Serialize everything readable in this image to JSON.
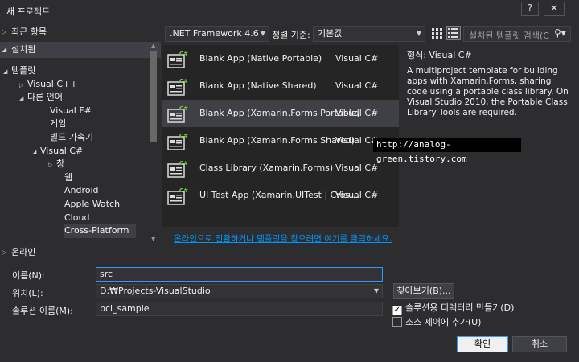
{
  "window": {
    "title": "새 프로젝트",
    "help": "?",
    "close": "✕"
  },
  "left": {
    "recent": "최근 항목",
    "installed": "설치됨",
    "online": "온라인",
    "tree": [
      {
        "label": "템플릿",
        "arrow": "◢",
        "indent": 0
      },
      {
        "label": "Visual C++",
        "arrow": "▷",
        "indent": 1
      },
      {
        "label": "다른 언어",
        "arrow": "◢",
        "indent": 1
      },
      {
        "label": "Visual F#",
        "arrow": "",
        "indent": 2
      },
      {
        "label": "게임",
        "arrow": "",
        "indent": 2
      },
      {
        "label": "빌드 가속기",
        "arrow": "",
        "indent": 2
      },
      {
        "label": "Visual C#",
        "arrow": "◢",
        "indent": 2
      },
      {
        "label": "창",
        "arrow": "▷",
        "indent": 3
      },
      {
        "label": "웹",
        "arrow": "",
        "indent": 3
      },
      {
        "label": "Android",
        "arrow": "",
        "indent": 3
      },
      {
        "label": "Apple Watch",
        "arrow": "",
        "indent": 3
      },
      {
        "label": "Cloud",
        "arrow": "",
        "indent": 3
      },
      {
        "label": "Cross-Platform",
        "arrow": "",
        "indent": 3,
        "selected": true
      }
    ]
  },
  "toolbar": {
    "framework": ".NET Framework 4.6",
    "sort_label": "정렬 기준:",
    "sort_value": "기본값",
    "search_placeholder": "설치된 템플릿 검색(C"
  },
  "templates": [
    {
      "name": "Blank App (Native Portable)",
      "lang": "Visual C#"
    },
    {
      "name": "Blank App (Native Shared)",
      "lang": "Visual C#"
    },
    {
      "name": "Blank App (Xamarin.Forms Portable)",
      "lang": "Visual C#",
      "selected": true
    },
    {
      "name": "Blank App (Xamarin.Forms Shared)",
      "lang": "Visual C#"
    },
    {
      "name": "Class Library (Xamarin.Forms)",
      "lang": "Visual C#"
    },
    {
      "name": "UI Test App (Xamarin.UITest | Cros...",
      "lang": "Visual C#"
    }
  ],
  "detail": {
    "type": "형식: Visual C#",
    "description": "A multiproject template for building apps with Xamarin.Forms, sharing code using a portable class library. On Visual Studio 2010, the Portable Class Library Tools are required."
  },
  "watermark": "http://analog-green.tistory.com",
  "online_link": "온라인으로 전환하거나 템플릿을 찾으려면 여기를 클릭하세요.",
  "form": {
    "name_label": "이름(N):",
    "name_value": "src",
    "location_label": "위치(L):",
    "location_value": "D:₩Projects-VisualStudio",
    "browse": "찾아보기(B)...",
    "solution_label": "솔루션 이름(M):",
    "solution_value": "pcl_sample",
    "create_dir": "솔루션용 디렉터리 만들기(D)",
    "create_dir_checked": true,
    "source_control": "소스 제어에 추가(U)",
    "source_control_checked": false,
    "ok": "확인",
    "cancel": "취소"
  },
  "colors": {
    "accent": "#3399ff",
    "link": "#0097fb",
    "background": "#2d2d30"
  }
}
